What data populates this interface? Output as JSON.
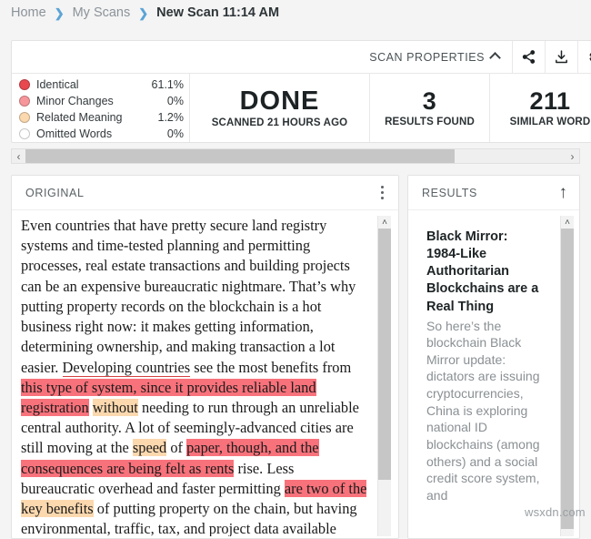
{
  "breadcrumb": {
    "items": [
      {
        "label": "Home",
        "current": false
      },
      {
        "label": "My Scans",
        "current": false
      },
      {
        "label": "New Scan 11:14 AM",
        "current": true
      }
    ],
    "separator": "❯"
  },
  "scan_properties": {
    "title": "SCAN PROPERTIES",
    "collapse_icon": "chevron-up-icon",
    "actions": [
      {
        "name": "share-icon",
        "label": "Share"
      },
      {
        "name": "download-icon",
        "label": "Download"
      },
      {
        "name": "gear-icon",
        "label": "Settings"
      }
    ],
    "legend": [
      {
        "label": "Identical",
        "value": "61.1%",
        "color": "#e8494f"
      },
      {
        "label": "Minor Changes",
        "value": "0%",
        "color": "#f6969b"
      },
      {
        "label": "Related Meaning",
        "value": "1.2%",
        "color": "#fbd8ae"
      },
      {
        "label": "Omitted Words",
        "value": "0%",
        "color": "#ffffff"
      }
    ],
    "stats": [
      {
        "value": "DONE",
        "label": "SCANNED 21 HOURS AGO"
      },
      {
        "value": "3",
        "label": "RESULTS FOUND"
      },
      {
        "value": "211",
        "label": "SIMILAR WORD"
      }
    ]
  },
  "hscroll": {
    "left_arrow": "‹",
    "right_arrow": "›"
  },
  "original_panel": {
    "title": "ORIGINAL",
    "menu_icon": "kebab-menu-icon",
    "scroll_up_arrow": "˄",
    "paragraph_segments": [
      {
        "text": "Even countries that have pretty secure land registry systems and time-tested planning and permitting processes, real estate transactions and building projects can be an expensive bureaucratic nightmare. That’s why putting property records on the blockchain is a hot business right now: it makes getting information, determining ownership, and making transaction a lot easier. ",
        "style": "plain"
      },
      {
        "text": "Developing countries",
        "style": "underline-red"
      },
      {
        "text": " see the most benefits from ",
        "style": "plain"
      },
      {
        "text": "this type of system, since it provides reliable land registration",
        "style": "red"
      },
      {
        "text": " ",
        "style": "plain"
      },
      {
        "text": "without",
        "style": "peach"
      },
      {
        "text": " needing to run through an unreliable central authority. A lot of seemingly-advanced cities are still moving at the ",
        "style": "plain"
      },
      {
        "text": "speed",
        "style": "peach"
      },
      {
        "text": " of ",
        "style": "plain"
      },
      {
        "text": "paper, though, and the consequences are being felt as rents",
        "style": "red"
      },
      {
        "text": " rise. Less bureaucratic overhead and faster permitting ",
        "style": "plain"
      },
      {
        "text": "are two of the",
        "style": "red"
      },
      {
        "text": " ",
        "style": "plain"
      },
      {
        "text": "key benefits",
        "style": "peach"
      },
      {
        "text": " of putting property on the chain, but having environmental, traffic, tax, and project data available",
        "style": "plain"
      }
    ]
  },
  "results_panel": {
    "title": "RESULTS",
    "collapse_icon": "arrow-up-icon",
    "collapse_glyph": "↑",
    "scroll_up_arrow": "˄",
    "items": [
      {
        "title": "Black Mirror: 1984-Like Authoritarian Blockchains are a Real Thing",
        "snippet": "So here’s the blockchain Black Mirror update: dictators are issuing cryptocurrencies, China is exploring national ID blockchains (among others) and a social credit score system, and"
      }
    ]
  },
  "watermark": "wsxdn.com"
}
